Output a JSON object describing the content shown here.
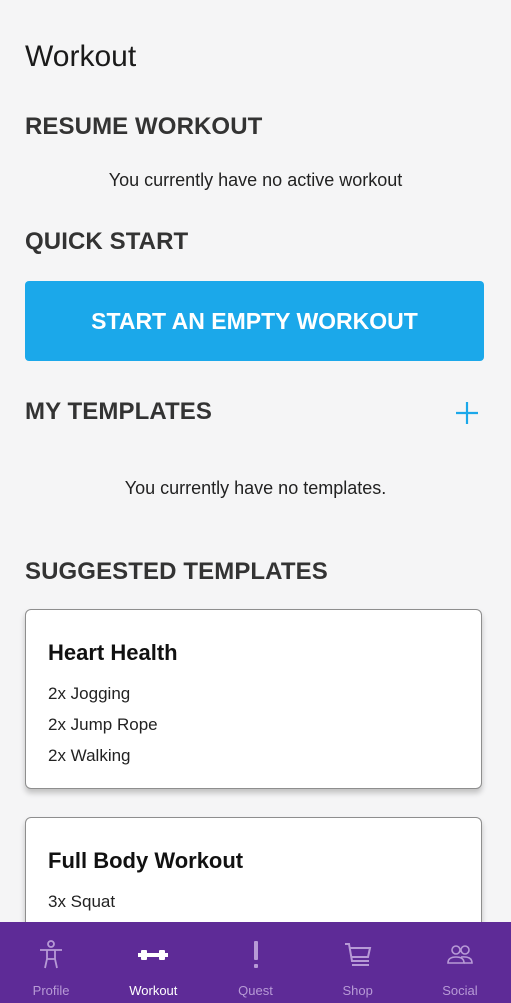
{
  "page": {
    "title": "Workout"
  },
  "resume": {
    "heading": "RESUME WORKOUT",
    "message": "You currently have no active workout"
  },
  "quick_start": {
    "heading": "QUICK START",
    "button_label": "START AN EMPTY WORKOUT"
  },
  "my_templates": {
    "heading": "MY TEMPLATES",
    "add_icon": "plus-icon",
    "message": "You currently have no templates."
  },
  "suggested": {
    "heading": "SUGGESTED TEMPLATES",
    "templates": [
      {
        "title": "Heart Health",
        "exercises": [
          "2x Jogging",
          "2x Jump Rope",
          "2x Walking"
        ]
      },
      {
        "title": "Full Body Workout",
        "exercises": [
          "3x Squat"
        ]
      }
    ]
  },
  "nav": {
    "active": "Workout",
    "items": [
      {
        "label": "Profile",
        "icon": "person-icon"
      },
      {
        "label": "Workout",
        "icon": "dumbbell-icon"
      },
      {
        "label": "Quest",
        "icon": "exclamation-icon"
      },
      {
        "label": "Shop",
        "icon": "cart-icon"
      },
      {
        "label": "Social",
        "icon": "people-icon"
      }
    ]
  },
  "colors": {
    "accent": "#1ba8ea",
    "nav_background": "#5e2b97",
    "nav_inactive": "#b79ad6",
    "background": "#f5f5f6"
  }
}
